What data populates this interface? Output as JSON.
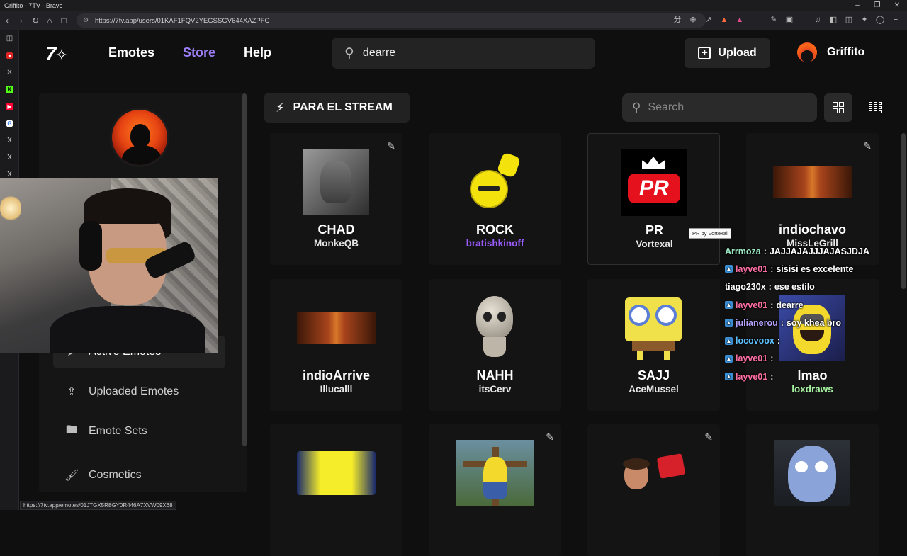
{
  "window": {
    "title": "Griffito - 7TV - Brave"
  },
  "browser": {
    "url": "https://7tv.app/users/01KAF1FQV2YEGSSGV644XAZPFC",
    "status_url": "https://7tv.app/emotes/01JTGX5R8GY0R446A7XVW09X68"
  },
  "nav": {
    "logo": "7",
    "links": [
      "Emotes",
      "Store",
      "Help"
    ],
    "search_value": "dearre",
    "upload_label": "Upload",
    "username": "Griffito",
    "accent": "#9b7ef5"
  },
  "sidebar": {
    "items": [
      {
        "label": "Active Emotes",
        "icon": "cursor-icon"
      },
      {
        "label": "Uploaded Emotes",
        "icon": "upload-icon"
      },
      {
        "label": "Emote Sets",
        "icon": "folder-icon"
      },
      {
        "label": "Cosmetics",
        "icon": "brush-icon"
      }
    ]
  },
  "main": {
    "collection_label": "PARA EL STREAM",
    "search_placeholder": "Search",
    "tooltip": "PR by Vortexal",
    "emotes": [
      {
        "name": "CHAD",
        "author": "MonkeQB",
        "author_color": "#ffffff",
        "edit": true
      },
      {
        "name": "ROCK",
        "author": "bratishkinoff",
        "author_color": "#9b5cff",
        "edit": false
      },
      {
        "name": "PR",
        "author": "Vortexal",
        "author_color": "#ffffff",
        "edit": false
      },
      {
        "name": "indiochavo",
        "author": "MissLeGrill",
        "author_color": "#ffffff",
        "edit": true
      },
      {
        "name": "indioArrive",
        "author": "Illucalll",
        "author_color": "#ffffff",
        "edit": false
      },
      {
        "name": "NAHH",
        "author": "itsCerv",
        "author_color": "#ffffff",
        "edit": false
      },
      {
        "name": "SAJJ",
        "author": "AceMussel",
        "author_color": "#ffffff",
        "edit": false
      },
      {
        "name": "lmao",
        "author": "loxdraws",
        "author_color": "#a6f2a0",
        "edit": false
      },
      {
        "name": "",
        "author": "",
        "author_color": "#ffffff",
        "edit": false
      },
      {
        "name": "",
        "author": "",
        "author_color": "#ffffff",
        "edit": true
      },
      {
        "name": "",
        "author": "",
        "author_color": "#ffffff",
        "edit": true
      },
      {
        "name": "",
        "author": "",
        "author_color": "#ffffff",
        "edit": false
      }
    ]
  },
  "chat": [
    {
      "user": "Arrmoza",
      "color": "#9be8c2",
      "text": "JAJJAJAJJJAJASJDJA",
      "badge": false
    },
    {
      "user": "layve01",
      "color": "#ff6fa3",
      "text": "sisisi es excelente",
      "badge": true
    },
    {
      "user": "tiago230x",
      "color": "#ffffff",
      "text": "ese estilo",
      "badge": false
    },
    {
      "user": "layve01",
      "color": "#ff6fa3",
      "text": "dearre",
      "badge": true
    },
    {
      "user": "julianerou",
      "color": "#b7a3ff",
      "text": "soy khea bro",
      "badge": true
    },
    {
      "user": "locovoox",
      "color": "#5fc2ff",
      "text": "",
      "badge": true
    },
    {
      "user": "layve01",
      "color": "#ff6fa3",
      "text": "",
      "badge": true
    },
    {
      "user": "layve01",
      "color": "#ff6fa3",
      "text": "",
      "badge": true
    }
  ]
}
